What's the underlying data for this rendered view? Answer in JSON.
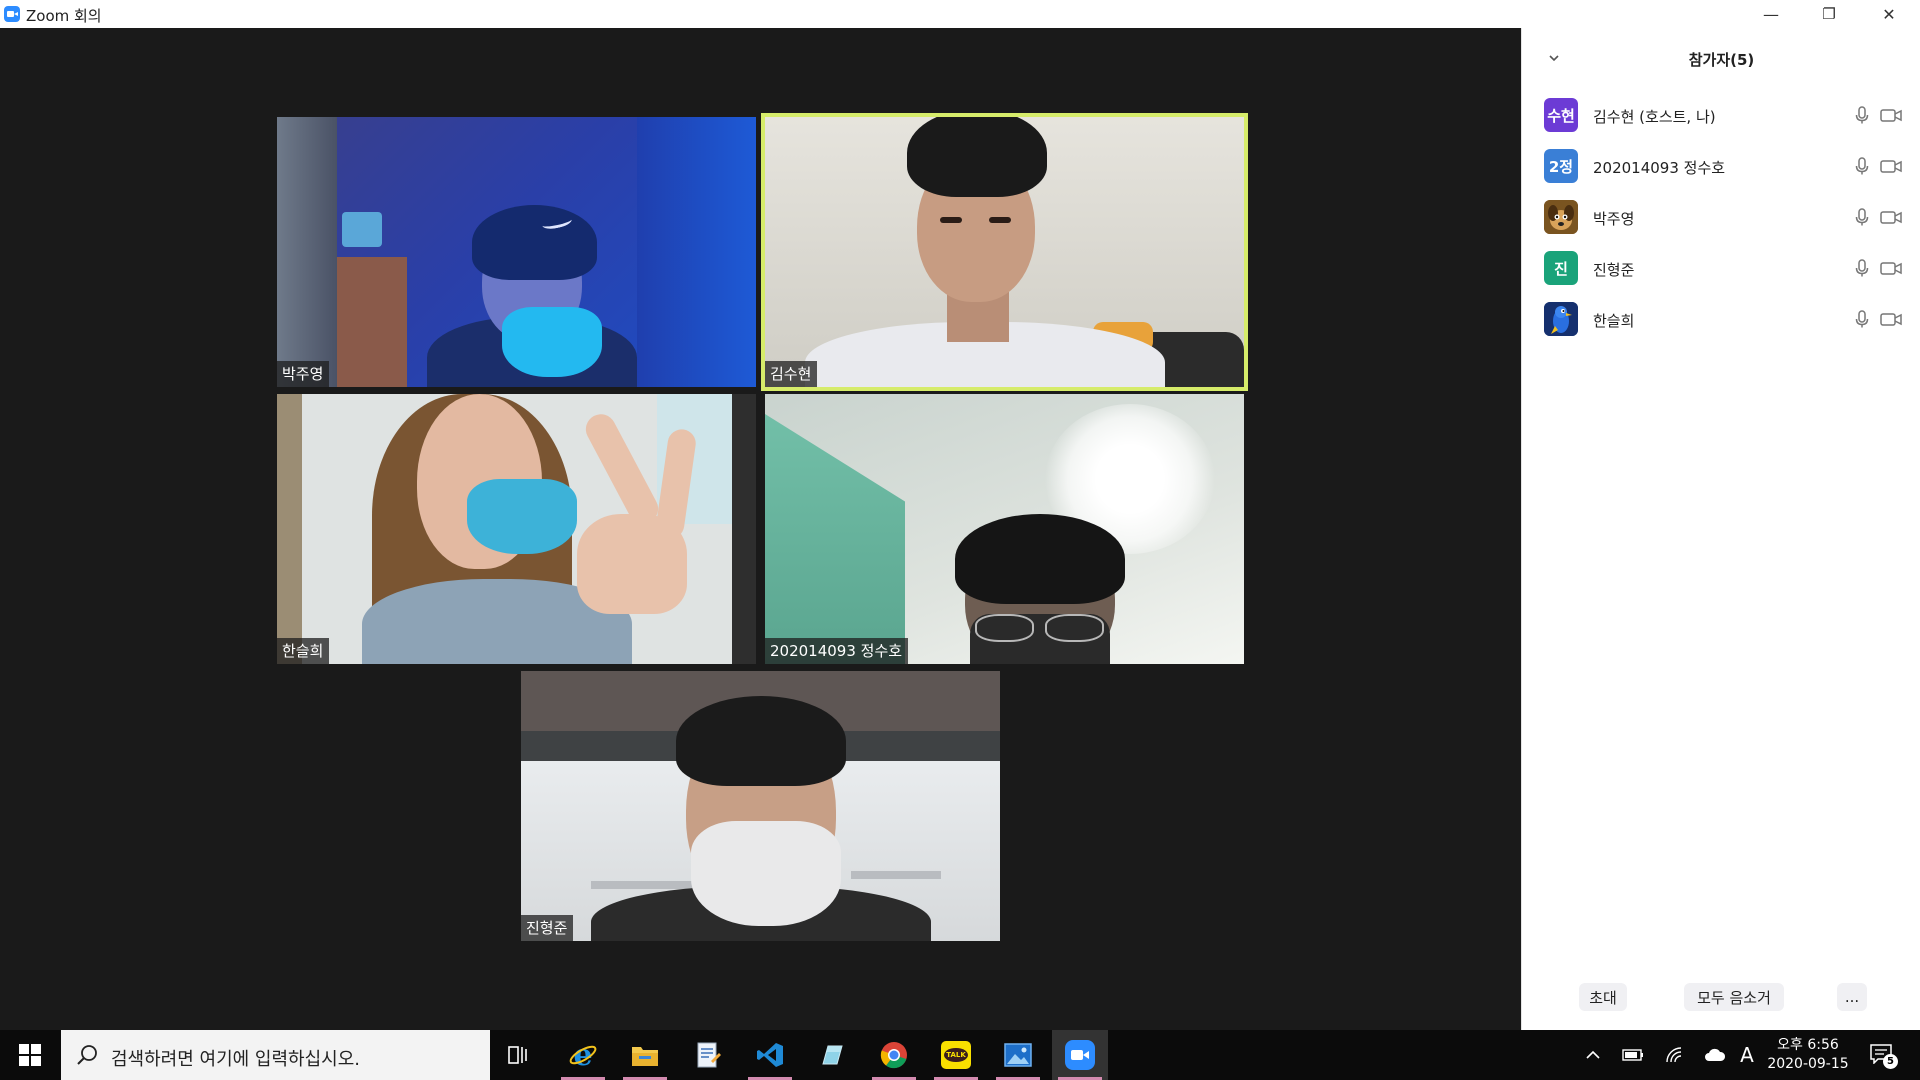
{
  "window": {
    "title": "Zoom 회의",
    "minimize": "—",
    "restore": "❐",
    "close": "✕"
  },
  "video_tiles": [
    {
      "name": "박주영",
      "active": false
    },
    {
      "name": "김수현",
      "active": true
    },
    {
      "name": "한슬희",
      "active": false
    },
    {
      "name": "202014093 정수호",
      "active": false
    },
    {
      "name": "진형준",
      "active": false
    }
  ],
  "participants_panel": {
    "title": "참가자(5)",
    "participants": [
      {
        "avatar_text": "수현",
        "avatar_color": "#6c3bd5",
        "name": "김수현 (호스트, 나)",
        "mic_icon": "mic-icon",
        "video_icon": "video-camera-icon"
      },
      {
        "avatar_text": "2정",
        "avatar_color": "#3a7fd6",
        "name": "202014093 정수호",
        "mic_icon": "mic-icon",
        "video_icon": "video-camera-icon"
      },
      {
        "avatar_text": "",
        "avatar_color": "#8a5a1e",
        "avatar_image": "dog-profile-picture",
        "name": "박주영",
        "mic_icon": "mic-icon",
        "video_icon": "video-camera-icon"
      },
      {
        "avatar_text": "진",
        "avatar_color": "#1aa37a",
        "name": "진형준",
        "mic_icon": "mic-icon",
        "video_icon": "video-camera-icon"
      },
      {
        "avatar_text": "",
        "avatar_color": "#1c3d8c",
        "avatar_image": "bird-profile-picture",
        "name": "한슬희",
        "mic_icon": "mic-icon",
        "video_icon": "video-camera-icon"
      }
    ],
    "buttons": {
      "invite": "초대",
      "mute_all": "모두 음소거",
      "more": "..."
    }
  },
  "taskbar": {
    "search_placeholder": "검색하려면 여기에 입력하십시오.",
    "apps": [
      "task-view-icon",
      "internet-explorer-icon",
      "file-explorer-icon",
      "notepad-icon",
      "visual-studio-code-icon",
      "app-icon",
      "chrome-icon",
      "kakaotalk-icon",
      "photos-icon",
      "zoom-icon"
    ],
    "kakao_label": "TALK",
    "tray": {
      "ime": "A",
      "time": "오후 6:56",
      "date": "2020-09-15",
      "notification_count": "5"
    }
  }
}
